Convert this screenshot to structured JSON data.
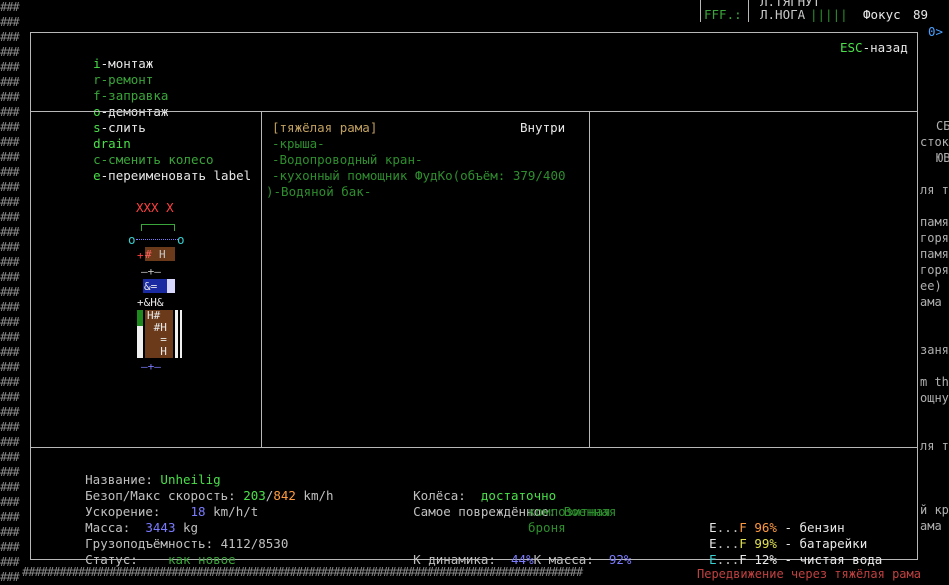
{
  "top_right": {
    "line1": "Л.ТЯГНУТ",
    "fff": "FFF.:",
    "leg": "Л.НОГА",
    "leg_bars": "|||||",
    "focus_label": "Фокус",
    "focus_value": "89",
    "prompt": "0>"
  },
  "hotkeys": [
    {
      "key": "i",
      "label": "-монтаж"
    },
    {
      "key": "r",
      "label": "-ремонт"
    },
    {
      "key": "f",
      "label": "-заправка"
    },
    {
      "key": "o",
      "label": "-демонтаж"
    },
    {
      "key": "s",
      "label": "-слить"
    },
    {
      "key": "drain",
      "label": ""
    },
    {
      "key": "c",
      "label": "-сменить колесо"
    },
    {
      "key": "e",
      "label": "-переименовать label"
    }
  ],
  "esc": {
    "key": "ESC",
    "label": "-назад"
  },
  "vehicle_preview": {
    "top_mark": "XXX X"
  },
  "parts_panel": {
    "header": "[тяжёлая рама]",
    "location": "Внутри",
    "items": [
      "-крыша-",
      "-Водопроводный кран-",
      "-кухонный помощник ФудКо(объём: 379/400",
      ")-Водяной бак-"
    ]
  },
  "stats": {
    "name_label": "Название:",
    "name_value": "Unheilig",
    "speed_label": "Безоп/Макс скорость:",
    "speed_safe": "203",
    "speed_sep": "/",
    "speed_max": "842",
    "speed_unit": "km/h",
    "accel_label": "Ускорение:",
    "accel_value": "18",
    "accel_unit": "km/h/t",
    "mass_label": "Масса:",
    "mass_value": "3443",
    "mass_unit": "kg",
    "cargo_label": "Грузоподъёмность:",
    "cargo_value": "4112/8530",
    "status_label": "Статус:",
    "status_value": "как новое",
    "wheels_label": "Колёса:",
    "wheels_value": "достаточно",
    "damaged_label": "Самое повреждённое:",
    "damaged_value_1": "Военная",
    "damaged_value_2": "композитная",
    "damaged_value_3": "броня",
    "dyn_label": "К динамика:",
    "dyn_value": "44%",
    "kmass_label": "К масса:",
    "kmass_value": "92%",
    "fuels": [
      {
        "e": "E",
        "dots": "...",
        "f": "F",
        "pct": "96%",
        "name": "- бензин"
      },
      {
        "e": "E",
        "dots": "...",
        "f": "F",
        "pct": "99%",
        "name": "- батарейки"
      },
      {
        "e": "E",
        "dots": "...",
        "f": "F",
        "pct": "12%",
        "name": "- чистая вода"
      }
    ]
  },
  "right_fragments": [
    "СБ",
    "сток",
    "ЮВ",
    "ля т",
    "памя",
    "горя",
    "памя",
    "горя",
    "ее)",
    "ама",
    "заня",
    "m th",
    "ощну",
    "ля т",
    "й кр",
    "ама"
  ],
  "bottom_log": "Передвижение через тяжёлая рама"
}
